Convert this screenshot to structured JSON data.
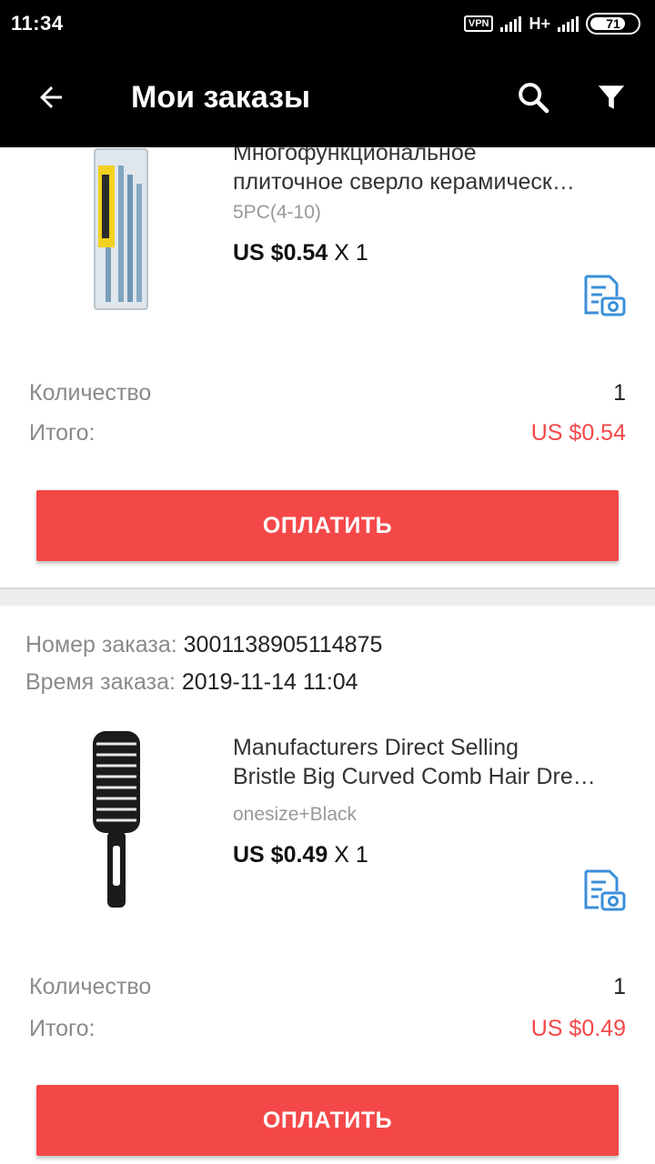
{
  "status_bar": {
    "time": "11:34",
    "vpn": "VPN",
    "network": "H+",
    "battery": "71"
  },
  "app_bar": {
    "title": "Мои заказы",
    "back_icon": "arrow-left-icon",
    "search_icon": "search-icon",
    "filter_icon": "filter-icon"
  },
  "orders": [
    {
      "product": {
        "title_line1": "Многофункциональное",
        "title_line2": "плиточное сверло керамическ…",
        "sku": "5PC(4-10)",
        "price": "US $0.54",
        "qty_text": "X 1"
      },
      "quantity_label": "Количество",
      "quantity_value": "1",
      "total_label": "Итого:",
      "total_value": "US $0.54",
      "pay_label": "ОПЛАТИТЬ"
    },
    {
      "order_number_label": "Номер заказа:",
      "order_number": "3001138905114875",
      "order_time_label": "Время заказа:",
      "order_time": "2019-11-14 11:04",
      "product": {
        "title_line1": "Manufacturers Direct Selling",
        "title_line2": "Bristle Big Curved Comb Hair Dre…",
        "sku": "onesize+Black",
        "price": "US $0.49",
        "qty_text": "X 1"
      },
      "quantity_label": "Количество",
      "quantity_value": "1",
      "total_label": "Итого:",
      "total_value": "US $0.49",
      "pay_label": "ОПЛАТИТЬ"
    }
  ],
  "colors": {
    "accent": "#f44848",
    "icon_blue": "#3b8fd8",
    "bar": "#000000"
  }
}
